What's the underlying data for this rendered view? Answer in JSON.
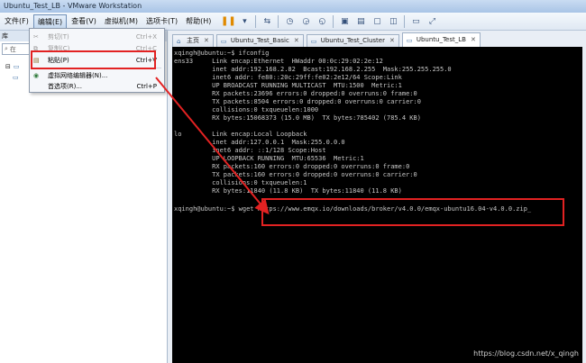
{
  "window": {
    "title": "Ubuntu_Test_LB - VMware Workstation"
  },
  "menubar": {
    "items": [
      "文件(F)",
      "编辑(E)",
      "查看(V)",
      "虚拟机(M)",
      "选项卡(T)",
      "帮助(H)"
    ]
  },
  "sidebar": {
    "header": "库",
    "search_placeholder": "在"
  },
  "edit_menu": {
    "items": [
      {
        "label": "剪切(T)",
        "shortcut": "Ctrl+X"
      },
      {
        "label": "复制(C)",
        "shortcut": "Ctrl+C"
      },
      {
        "label": "粘贴(P)",
        "shortcut": "Ctrl+V"
      },
      {
        "label": "虚拟网络编辑器(N)...",
        "shortcut": ""
      },
      {
        "label": "首选项(R)...",
        "shortcut": "Ctrl+P"
      }
    ]
  },
  "tabs": [
    {
      "label": "主页"
    },
    {
      "label": "Ubuntu_Test_Basic"
    },
    {
      "label": "Ubuntu_Test_Cluster"
    },
    {
      "label": "Ubuntu_Test_LB"
    }
  ],
  "terminal": {
    "lines": [
      "xqingh@ubuntu:~$ ifconfig",
      "ens33     Link encap:Ethernet  HWaddr 00:0c:29:02:2e:12",
      "          inet addr:192.168.2.82  Bcast:192.168.2.255  Mask:255.255.255.0",
      "          inet6 addr: fe80::20c:29ff:fe02:2e12/64 Scope:Link",
      "          UP BROADCAST RUNNING MULTICAST  MTU:1500  Metric:1",
      "          RX packets:23696 errors:0 dropped:0 overruns:0 frame:0",
      "          TX packets:8504 errors:0 dropped:0 overruns:0 carrier:0",
      "          collisions:0 txqueuelen:1000",
      "          RX bytes:15068373 (15.0 MB)  TX bytes:785402 (785.4 KB)",
      "",
      "lo        Link encap:Local Loopback",
      "          inet addr:127.0.0.1  Mask:255.0.0.0",
      "          inet6 addr: ::1/128 Scope:Host",
      "          UP LOOPBACK RUNNING  MTU:65536  Metric:1",
      "          RX packets:160 errors:0 dropped:0 overruns:0 frame:0",
      "          TX packets:160 errors:0 dropped:0 overruns:0 carrier:0",
      "          collisions:0 txqueuelen:1",
      "          RX bytes:11840 (11.8 KB)  TX bytes:11840 (11.8 KB)",
      "",
      "xqingh@ubuntu:~$ wget https://www.emqx.io/downloads/broker/v4.0.0/emqx-ubuntu16.04-v4.0.0.zip_"
    ]
  },
  "watermark": "https://blog.csdn.net/x_qingh",
  "colors": {
    "highlight": "#e22222",
    "terminal_bg": "#000000",
    "terminal_fg": "#c7c7c7"
  }
}
